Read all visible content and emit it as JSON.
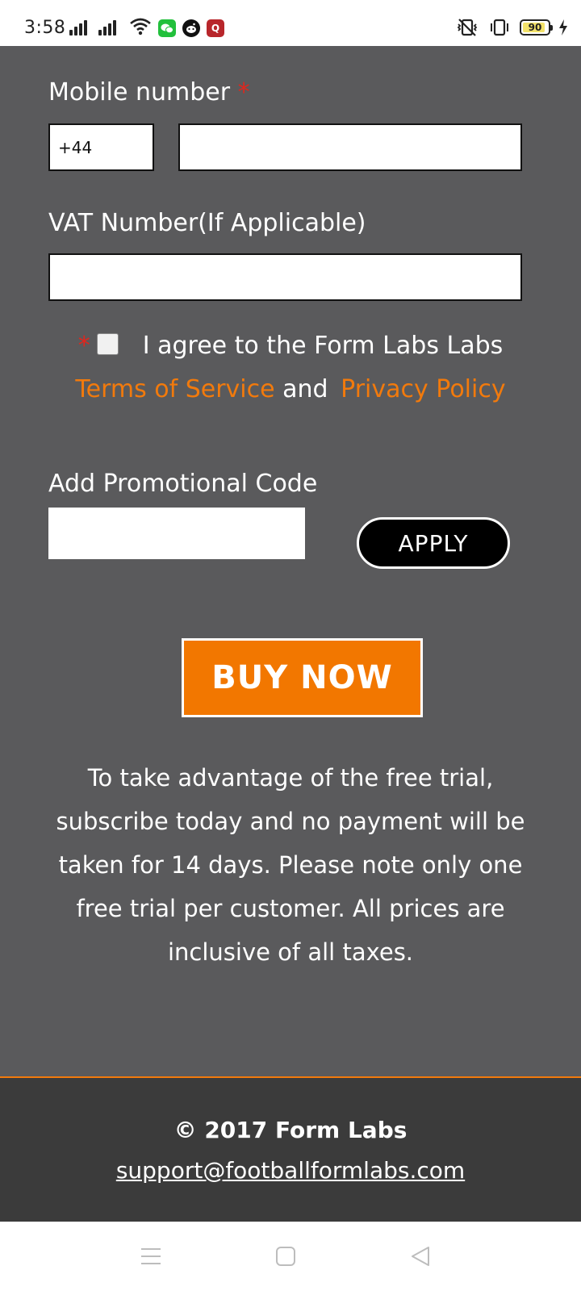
{
  "status_bar": {
    "time": "3:58",
    "battery_level": "90",
    "battery_fraction": 0.9,
    "icons": [
      "signal-icon",
      "signal-icon",
      "wifi-icon",
      "wechat-icon",
      "reddit-icon",
      "quora-icon",
      "vibrate-off-icon",
      "vibrate-icon",
      "battery-icon",
      "charging-icon"
    ]
  },
  "form": {
    "mobile_label": "Mobile number",
    "required_mark": "*",
    "country_code_value": "+44",
    "mobile_value": "",
    "vat_label": "VAT Number(If Applicable)",
    "vat_value": "",
    "agree_text": "I agree to the Form Labs Labs",
    "terms_link": "Terms of Service",
    "and_text": "and",
    "privacy_link": "Privacy Policy",
    "promo_label": "Add Promotional Code",
    "promo_value": "",
    "apply_label": "APPLY",
    "buy_label": "BUY NOW",
    "notice": "To take advantage of the free trial, subscribe today and no payment will be taken for 14 days. Please note only one free trial per customer. All prices are inclusive of all taxes."
  },
  "footer": {
    "copyright": "© 2017 Form Labs",
    "email": "support@footballformlabs.com"
  },
  "colors": {
    "accent": "#f27700",
    "page_bg": "#5a5a5c",
    "footer_bg": "#3b3b3b",
    "required": "#e0261d"
  }
}
